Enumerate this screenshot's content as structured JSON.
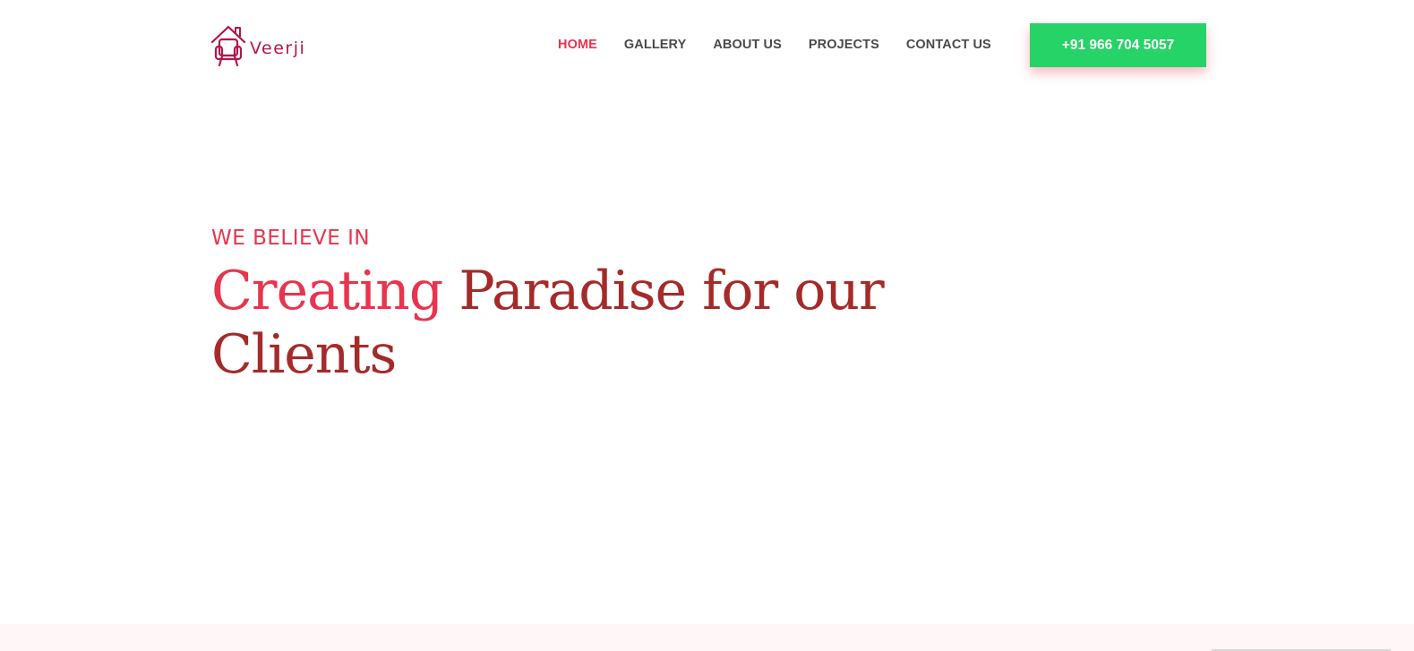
{
  "brand": {
    "name": "Veerji",
    "logo_icon": "house-armchair-icon",
    "color": "#b0174b"
  },
  "nav": {
    "items": [
      {
        "label": "HOME",
        "active": true
      },
      {
        "label": "GALLERY",
        "active": false
      },
      {
        "label": "ABOUT US",
        "active": false
      },
      {
        "label": "PROJECTS",
        "active": false
      },
      {
        "label": "CONTACT US",
        "active": false
      }
    ],
    "active_color": "#e8344e",
    "text_color": "#4a4a4a"
  },
  "cta": {
    "phone_label": "+91 966 704 5057",
    "background": "#25d366"
  },
  "hero": {
    "eyebrow": "WE BELIEVE IN",
    "headline_accent": "Creating",
    "headline_rest": "Paradise for our Clients",
    "accent_color": "#e8344e",
    "headline_color": "#a52a2a"
  }
}
